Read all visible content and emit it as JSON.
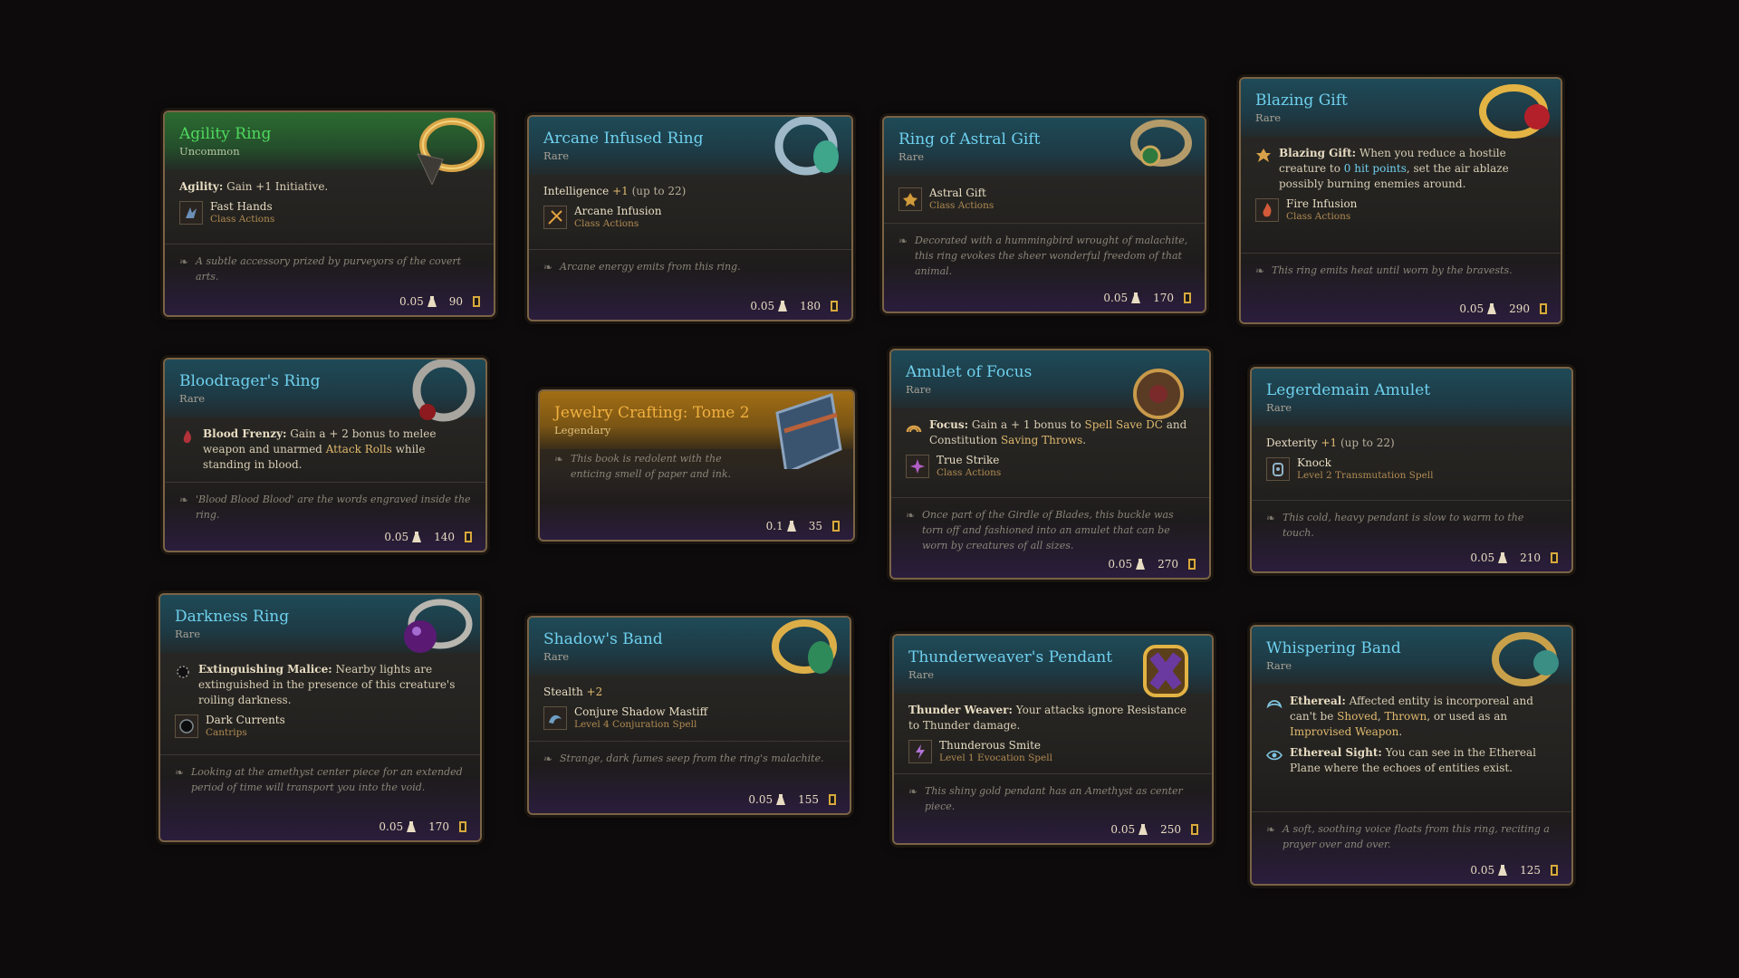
{
  "cards": [
    {
      "id": "agility-ring",
      "title": "Agility Ring",
      "rarity": "Uncommon",
      "effect_kw": "Agility:",
      "effect_text": " Gain +1 Initiative.",
      "ability": {
        "name": "Fast Hands",
        "sub": "Class Actions",
        "icon": "fast-hands-icon"
      },
      "flavor": "A subtle accessory prized by purveyors of the covert arts.",
      "weight": "0.05",
      "price": "90"
    },
    {
      "id": "arcane-infused-ring",
      "title": "Arcane Infused Ring",
      "rarity": "Rare",
      "stat_name": "Intelligence",
      "stat_bonus": "+1",
      "stat_cap": "(up to 22)",
      "ability": {
        "name": "Arcane Infusion",
        "sub": "Class Actions",
        "icon": "arcane-infusion-icon"
      },
      "flavor": "Arcane energy emits from this ring.",
      "weight": "0.05",
      "price": "180"
    },
    {
      "id": "ring-of-astral-gift",
      "title": "Ring of Astral Gift",
      "rarity": "Rare",
      "ability": {
        "name": "Astral Gift",
        "sub": "Class Actions",
        "icon": "astral-gift-icon"
      },
      "flavor": "Decorated with a hummingbird wrought of malachite, this ring evokes the sheer wonderful freedom of that animal.",
      "weight": "0.05",
      "price": "170"
    },
    {
      "id": "blazing-gift",
      "title": "Blazing Gift",
      "rarity": "Rare",
      "effect_kw": "Blazing Gift:",
      "effect_pre": " When you reduce a hostile creature to ",
      "effect_link": "0 hit points",
      "effect_post": ", set the air ablaze possibly burning enemies around.",
      "ability": {
        "name": "Fire Infusion",
        "sub": "Class Actions",
        "icon": "fire-infusion-icon"
      },
      "flavor": "This ring emits heat until worn by the bravests.",
      "weight": "0.05",
      "price": "290"
    },
    {
      "id": "bloodragers-ring",
      "title": "Bloodrager's Ring",
      "rarity": "Rare",
      "effect_kw": "Blood Frenzy:",
      "effect_pre": " Gain a + 2 bonus to melee weapon and unarmed ",
      "effect_link": "Attack Rolls",
      "effect_post": " while standing in blood.",
      "flavor": "'Blood Blood Blood' are the words engraved inside the ring.",
      "weight": "0.05",
      "price": "140"
    },
    {
      "id": "jewelry-crafting-tome-2",
      "title": "Jewelry Crafting: Tome 2",
      "rarity": "Legendary",
      "flavor": "This book is redolent with the enticing smell of paper and ink.",
      "weight": "0.1",
      "price": "35"
    },
    {
      "id": "amulet-of-focus",
      "title": "Amulet of Focus",
      "rarity": "Rare",
      "effect_kw": "Focus:",
      "effect_pre": " Gain a + 1 bonus to ",
      "effect_link": "Spell Save DC",
      "effect_mid": " and Constitution ",
      "effect_link2": "Saving Throws",
      "effect_post": ".",
      "ability": {
        "name": "True Strike",
        "sub": "Class Actions",
        "icon": "true-strike-icon"
      },
      "flavor": "Once part of the Girdle of Blades, this buckle was torn off and fashioned into an amulet that can be worn by creatures of all sizes.",
      "weight": "0.05",
      "price": "270"
    },
    {
      "id": "legerdemain-amulet",
      "title": "Legerdemain Amulet",
      "rarity": "Rare",
      "stat_name": "Dexterity",
      "stat_bonus": "+1",
      "stat_cap": "(up to 22)",
      "ability": {
        "name": "Knock",
        "sub": "Level 2 Transmutation Spell",
        "icon": "knock-icon"
      },
      "flavor": "This cold, heavy pendant is slow to warm to the touch.",
      "weight": "0.05",
      "price": "210"
    },
    {
      "id": "darkness-ring",
      "title": "Darkness Ring",
      "rarity": "Rare",
      "effect_kw": "Extinguishing Malice:",
      "effect_text": " Nearby lights are extinguished in the presence of this creature's roiling darkness.",
      "ability": {
        "name": "Dark Currents",
        "sub": "Cantrips",
        "icon": "dark-currents-icon"
      },
      "flavor": "Looking at the amethyst center piece for an extended period of time will transport you into the void.",
      "weight": "0.05",
      "price": "170"
    },
    {
      "id": "shadows-band",
      "title": "Shadow's Band",
      "rarity": "Rare",
      "stat_name": "Stealth",
      "stat_bonus": "+2",
      "ability": {
        "name": "Conjure Shadow Mastiff",
        "sub": "Level 4 Conjuration Spell",
        "icon": "shadow-mastiff-icon"
      },
      "flavor": "Strange, dark fumes seep from the ring's malachite.",
      "weight": "0.05",
      "price": "155"
    },
    {
      "id": "thunderweavers-pendant",
      "title": "Thunderweaver's Pendant",
      "rarity": "Rare",
      "effect_kw": "Thunder Weaver:",
      "effect_text": " Your attacks ignore Resistance to Thunder damage.",
      "ability": {
        "name": "Thunderous Smite",
        "sub": "Level 1 Evocation Spell",
        "icon": "thunderous-smite-icon"
      },
      "flavor": "This shiny gold pendant has an Amethyst as center piece.",
      "weight": "0.05",
      "price": "250"
    },
    {
      "id": "whispering-band",
      "title": "Whispering Band",
      "rarity": "Rare",
      "effect_kw": "Ethereal:",
      "effect_pre": " Affected entity is incorporeal and can't be ",
      "effect_link": "Shoved",
      "effect_mid": ", ",
      "effect_link2": "Thrown",
      "effect_mid2": ", or used as an ",
      "effect_link3": "Improvised Weapon",
      "effect_post": ".",
      "effect2_kw": "Ethereal Sight:",
      "effect2_text": " You can see in the Ethereal Plane where the echoes of entities exist.",
      "flavor": "A soft, soothing voice floats from this ring, reciting a prayer over and over.",
      "weight": "0.05",
      "price": "125"
    }
  ]
}
